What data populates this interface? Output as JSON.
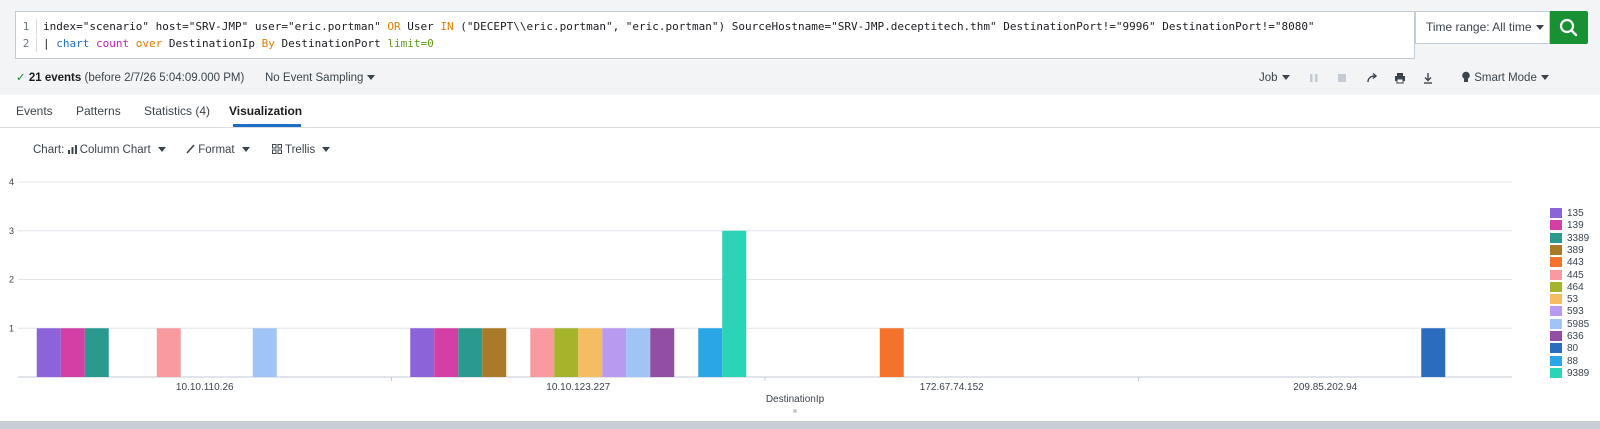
{
  "query": {
    "line1": {
      "num": "1",
      "parts": [
        "index=\"scenario\" host=\"SRV-JMP\" user=\"eric.portman\" ",
        "OR",
        " User ",
        "IN",
        " (\"DECEPT\\\\eric.portman\", \"eric.portman\") SourceHostname=\"SRV-JMP.deceptitech.thm\" DestinationPort!=\"9996\" DestinationPort!=\"8080\""
      ]
    },
    "line2": {
      "num": "2",
      "pipe": "| ",
      "cmd": "chart",
      "fn": "count",
      "over": "over",
      "field1": "DestinationIp",
      "by": "By",
      "field2": "DestinationPort",
      "limit": "limit=0"
    }
  },
  "time_range": {
    "label": "Time range: All time"
  },
  "search_button": {
    "icon": "search-icon",
    "color": "#1a9035"
  },
  "status": {
    "check": "✓",
    "events": "21 events",
    "before": "(before 2/7/26 5:04:09.000 PM)",
    "sampling": "No Event Sampling",
    "job": "Job",
    "smart_mode": "Smart Mode"
  },
  "tabs": [
    {
      "label": "Events"
    },
    {
      "label": "Patterns"
    },
    {
      "label": "Statistics (4)"
    },
    {
      "label": "Visualization",
      "active": true
    }
  ],
  "viz_toolbar": {
    "chart_label": "Chart:",
    "chart_type": "Column Chart",
    "format": "Format",
    "trellis": "Trellis"
  },
  "chart_data": {
    "type": "bar",
    "xlabel": "DestinationIp",
    "ylabel": "",
    "ylim": [
      0,
      4
    ],
    "yticks": [
      1,
      2,
      3,
      4
    ],
    "categories": [
      "10.10.110.26",
      "10.10.123.227",
      "172.67.74.152",
      "209.85.202.94"
    ],
    "series": [
      {
        "name": "135",
        "color": "#8c63d8",
        "values": [
          1,
          1,
          0,
          0
        ]
      },
      {
        "name": "139",
        "color": "#d43fa6",
        "values": [
          1,
          1,
          0,
          0
        ]
      },
      {
        "name": "3389",
        "color": "#2a9a8e",
        "values": [
          1,
          1,
          0,
          0
        ]
      },
      {
        "name": "389",
        "color": "#a97a27",
        "values": [
          0,
          1,
          0,
          0
        ]
      },
      {
        "name": "443",
        "color": "#f4722b",
        "values": [
          0,
          0,
          1,
          0
        ]
      },
      {
        "name": "445",
        "color": "#f99aa0",
        "values": [
          1,
          1,
          0,
          0
        ]
      },
      {
        "name": "464",
        "color": "#a5b42b",
        "values": [
          0,
          1,
          0,
          0
        ]
      },
      {
        "name": "53",
        "color": "#f5bc62",
        "values": [
          0,
          1,
          0,
          0
        ]
      },
      {
        "name": "593",
        "color": "#b99af1",
        "values": [
          0,
          1,
          0,
          0
        ]
      },
      {
        "name": "5985",
        "color": "#9fc4f5",
        "values": [
          1,
          1,
          0,
          0
        ]
      },
      {
        "name": "636",
        "color": "#924ea3",
        "values": [
          0,
          1,
          0,
          0
        ]
      },
      {
        "name": "80",
        "color": "#2b6cbf",
        "values": [
          0,
          0,
          0,
          1
        ]
      },
      {
        "name": "88",
        "color": "#2aa5e6",
        "values": [
          0,
          1,
          0,
          0
        ]
      },
      {
        "name": "9389",
        "color": "#2bd4b7",
        "values": [
          0,
          3,
          0,
          0
        ]
      }
    ]
  }
}
